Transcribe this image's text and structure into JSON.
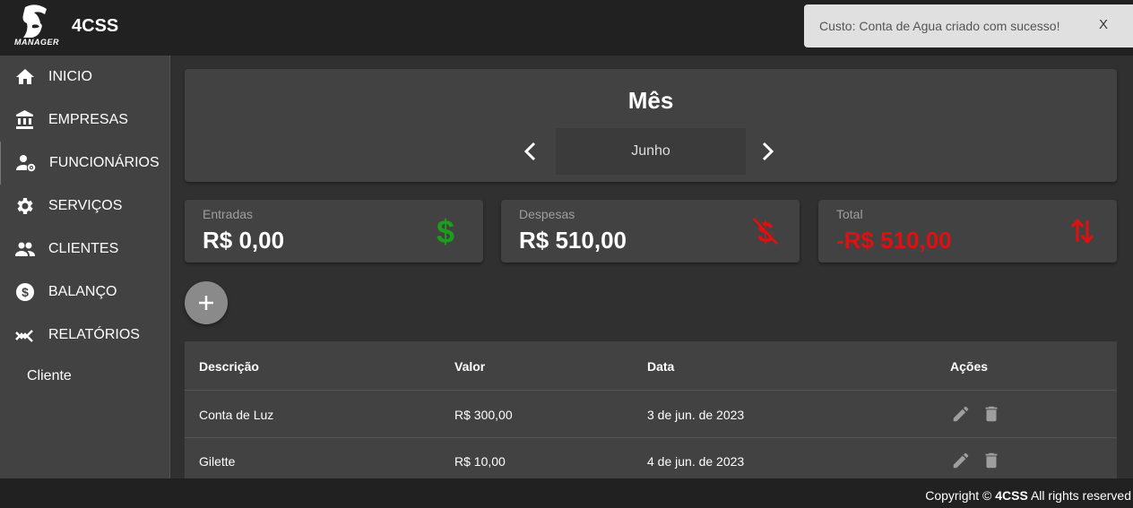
{
  "app": {
    "brand": "4CSS",
    "logo_text": "MANAGER"
  },
  "toast": {
    "message": "Custo: Conta de Agua criado com sucesso!",
    "close_label": "X"
  },
  "sidebar": {
    "items": [
      {
        "label": "INICIO",
        "icon": "home-icon"
      },
      {
        "label": "EMPRESAS",
        "icon": "bank-icon"
      },
      {
        "label": "FUNCIONÁRIOS",
        "icon": "user-gear-icon"
      },
      {
        "label": "SERVIÇOS",
        "icon": "gear-icon"
      },
      {
        "label": "CLIENTES",
        "icon": "people-icon"
      },
      {
        "label": "BALANÇO",
        "icon": "dollar-circle-icon"
      },
      {
        "label": "RELATÓRIOS",
        "icon": "chart-icon"
      }
    ],
    "sub_item": "Cliente"
  },
  "month": {
    "title": "Mês",
    "value": "Junho"
  },
  "stats": {
    "entradas": {
      "label": "Entradas",
      "value": "R$ 0,00",
      "icon_color": "#1b9e1b"
    },
    "despesas": {
      "label": "Despesas",
      "value": "R$ 510,00",
      "icon_color": "#e01010"
    },
    "total": {
      "label": "Total",
      "value": "-R$ 510,00",
      "value_color": "#e01010",
      "icon_color": "#e01010"
    }
  },
  "table": {
    "headers": {
      "descricao": "Descrição",
      "valor": "Valor",
      "data": "Data",
      "acoes": "Ações"
    },
    "rows": [
      {
        "descricao": "Conta de Luz",
        "valor": "R$ 300,00",
        "data": "3 de jun. de 2023"
      },
      {
        "descricao": "Gilette",
        "valor": "R$ 10,00",
        "data": "4 de jun. de 2023"
      }
    ]
  },
  "footer": {
    "prefix": "Copyright ©",
    "brand": "4CSS",
    "suffix": "All rights reserved"
  },
  "colors": {
    "background": "#303030",
    "card": "#424242",
    "topbar": "#212121",
    "positive": "#1b9e1b",
    "negative": "#e01010"
  }
}
